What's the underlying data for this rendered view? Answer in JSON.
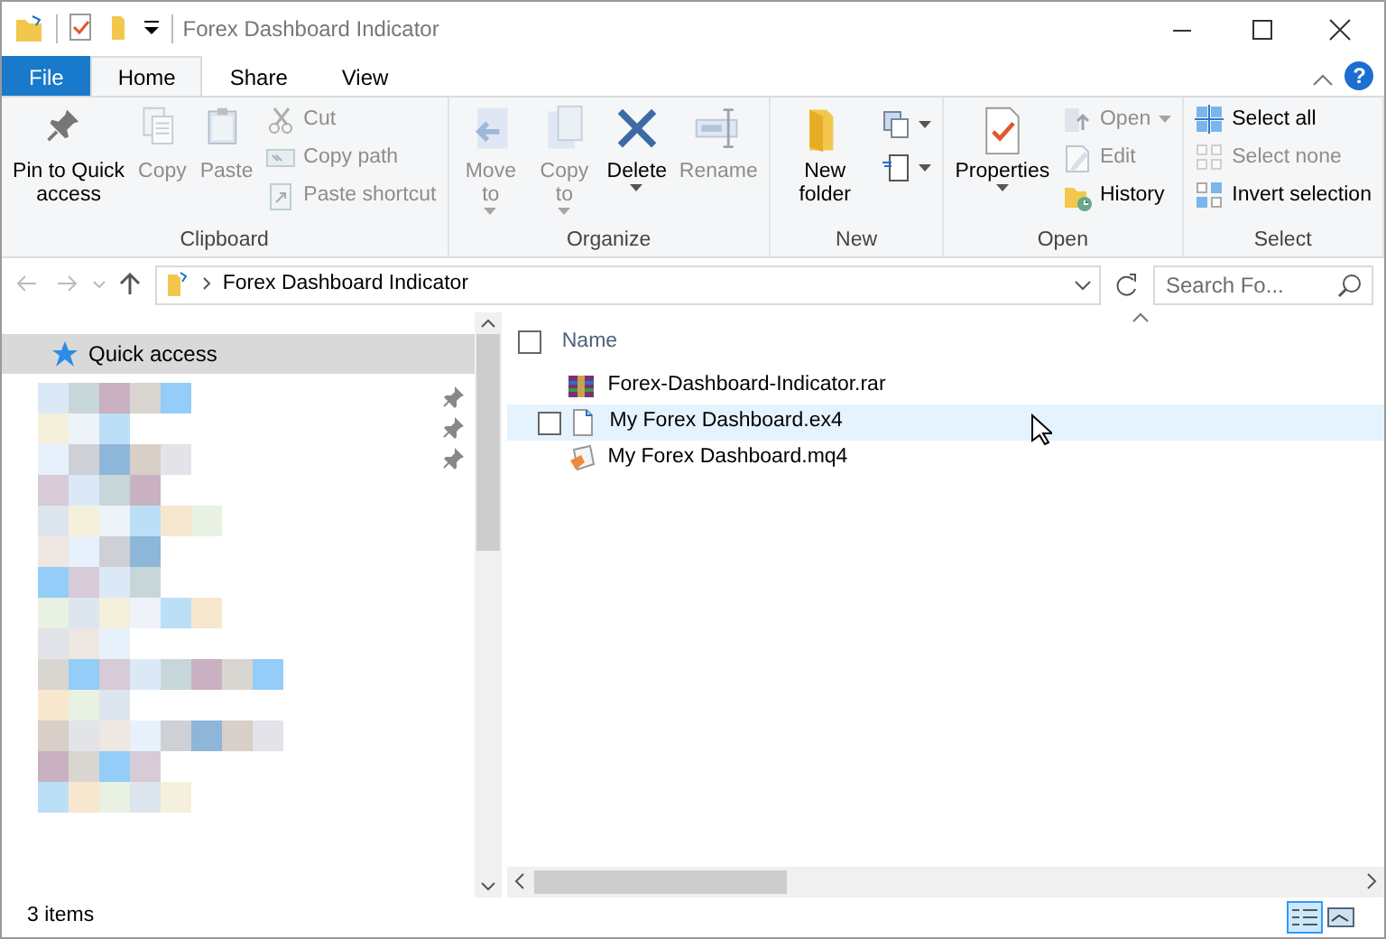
{
  "window": {
    "title": "Forex Dashboard Indicator"
  },
  "ribbon_tabs": [
    {
      "label": "File",
      "kind": "file",
      "selected": false
    },
    {
      "label": "Home",
      "kind": "tab",
      "selected": true
    },
    {
      "label": "Share",
      "kind": "tab",
      "selected": false
    },
    {
      "label": "View",
      "kind": "tab",
      "selected": false
    }
  ],
  "ribbon_groups": [
    {
      "label": "Clipboard",
      "commands": [
        {
          "label": "Pin to Quick access",
          "kind": "large",
          "disabled": false,
          "dropdown": false
        },
        {
          "label": "Copy",
          "kind": "large",
          "disabled": true,
          "dropdown": false
        },
        {
          "label": "Paste",
          "kind": "large",
          "disabled": true,
          "dropdown": false
        },
        {
          "label": "Cut",
          "kind": "small",
          "disabled": true,
          "dropdown": false
        },
        {
          "label": "Copy path",
          "kind": "small",
          "disabled": true,
          "dropdown": false
        },
        {
          "label": "Paste shortcut",
          "kind": "small",
          "disabled": true,
          "dropdown": false
        }
      ]
    },
    {
      "label": "Organize",
      "commands": [
        {
          "label": "Move to",
          "kind": "large",
          "disabled": true,
          "dropdown": true
        },
        {
          "label": "Copy to",
          "kind": "large",
          "disabled": true,
          "dropdown": true
        },
        {
          "label": "Delete",
          "kind": "large",
          "disabled": false,
          "dropdown": true
        },
        {
          "label": "Rename",
          "kind": "large",
          "disabled": true,
          "dropdown": false
        }
      ]
    },
    {
      "label": "New",
      "commands": [
        {
          "label": "New folder",
          "kind": "large",
          "disabled": false,
          "dropdown": false
        },
        {
          "kind": "mini",
          "disabled": false,
          "dropdown": true
        },
        {
          "kind": "mini",
          "disabled": false,
          "dropdown": true
        }
      ]
    },
    {
      "label": "Open",
      "commands": [
        {
          "label": "Properties",
          "kind": "large",
          "disabled": false,
          "dropdown": true
        },
        {
          "label": "Open",
          "kind": "small",
          "disabled": true,
          "dropdown": true
        },
        {
          "label": "Edit",
          "kind": "small",
          "disabled": true,
          "dropdown": false
        },
        {
          "label": "History",
          "kind": "small",
          "disabled": false,
          "dropdown": false
        }
      ]
    },
    {
      "label": "Select",
      "commands": [
        {
          "label": "Select all",
          "kind": "small",
          "disabled": false,
          "dropdown": false
        },
        {
          "label": "Select none",
          "kind": "small",
          "disabled": true,
          "dropdown": false
        },
        {
          "label": "Invert selection",
          "kind": "small",
          "disabled": false,
          "dropdown": false
        }
      ]
    }
  ],
  "help_button": {
    "label": "?"
  },
  "address_bar": {
    "path": [
      "Forex Dashboard Indicator"
    ]
  },
  "search": {
    "placeholder": "Search Fo..."
  },
  "sidebar": {
    "items": [
      {
        "label": "Quick access",
        "selected": true
      }
    ],
    "hidden_items": [
      {
        "pinned": true
      },
      {
        "pinned": true
      },
      {
        "pinned": true
      },
      {
        "pinned": false
      },
      {
        "pinned": false
      },
      {
        "pinned": false
      },
      {
        "pinned": false
      },
      {
        "pinned": false
      },
      {
        "pinned": false
      },
      {
        "pinned": false
      },
      {
        "pinned": false
      },
      {
        "pinned": false
      },
      {
        "pinned": false
      },
      {
        "pinned": false
      }
    ]
  },
  "file_list": {
    "columns": [
      "Name"
    ],
    "all_checked": false,
    "rows": [
      {
        "name": "Forex-Dashboard-Indicator.rar",
        "kind": "archive",
        "hovered": false
      },
      {
        "name": "My Forex Dashboard.ex4",
        "kind": "file",
        "hovered": true,
        "checked": false
      },
      {
        "name": "My Forex Dashboard.mq4",
        "kind": "source",
        "hovered": false
      }
    ]
  },
  "status_bar": {
    "text": "3 items",
    "views": [
      {
        "kind": "details",
        "selected": true
      },
      {
        "kind": "tiles",
        "selected": false
      }
    ]
  }
}
